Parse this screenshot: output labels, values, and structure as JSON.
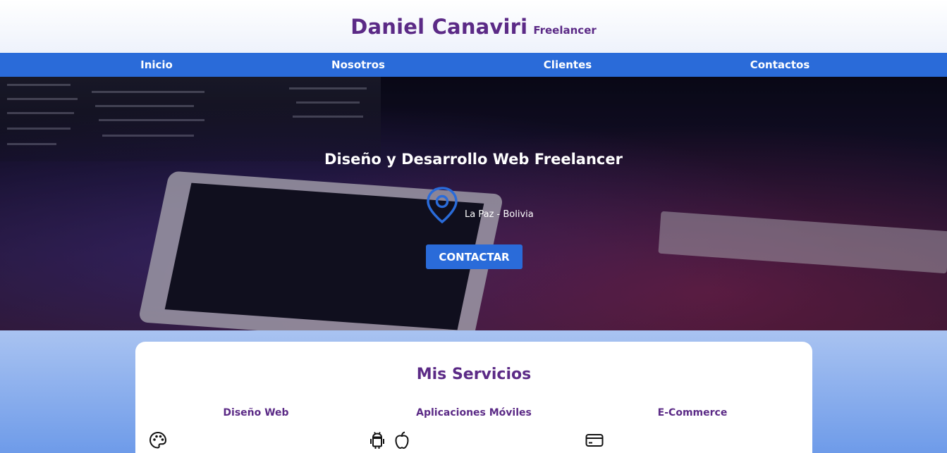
{
  "header": {
    "name": "Daniel Canaviri",
    "subtitle": "Freelancer"
  },
  "nav": {
    "items": [
      {
        "label": "Inicio"
      },
      {
        "label": "Nosotros"
      },
      {
        "label": "Clientes"
      },
      {
        "label": "Contactos"
      }
    ]
  },
  "hero": {
    "title": "Diseño y Desarrollo Web Freelancer",
    "location": "La Paz - Bolivia",
    "location_icon": "map-pin-icon",
    "cta_label": "CONTACTAR"
  },
  "services": {
    "title": "Mis Servicios",
    "items": [
      {
        "title": "Diseño Web",
        "icons": [
          "palette-icon"
        ]
      },
      {
        "title": "Aplicaciones Móviles",
        "icons": [
          "android-icon",
          "apple-icon"
        ]
      },
      {
        "title": "E-Commerce",
        "icons": [
          "credit-card-icon"
        ]
      }
    ]
  },
  "colors": {
    "brand_purple": "#5b2a86",
    "nav_blue": "#2a6bd9",
    "services_bg_top": "#a9c3f1",
    "services_bg_bottom": "#6e9be9"
  }
}
